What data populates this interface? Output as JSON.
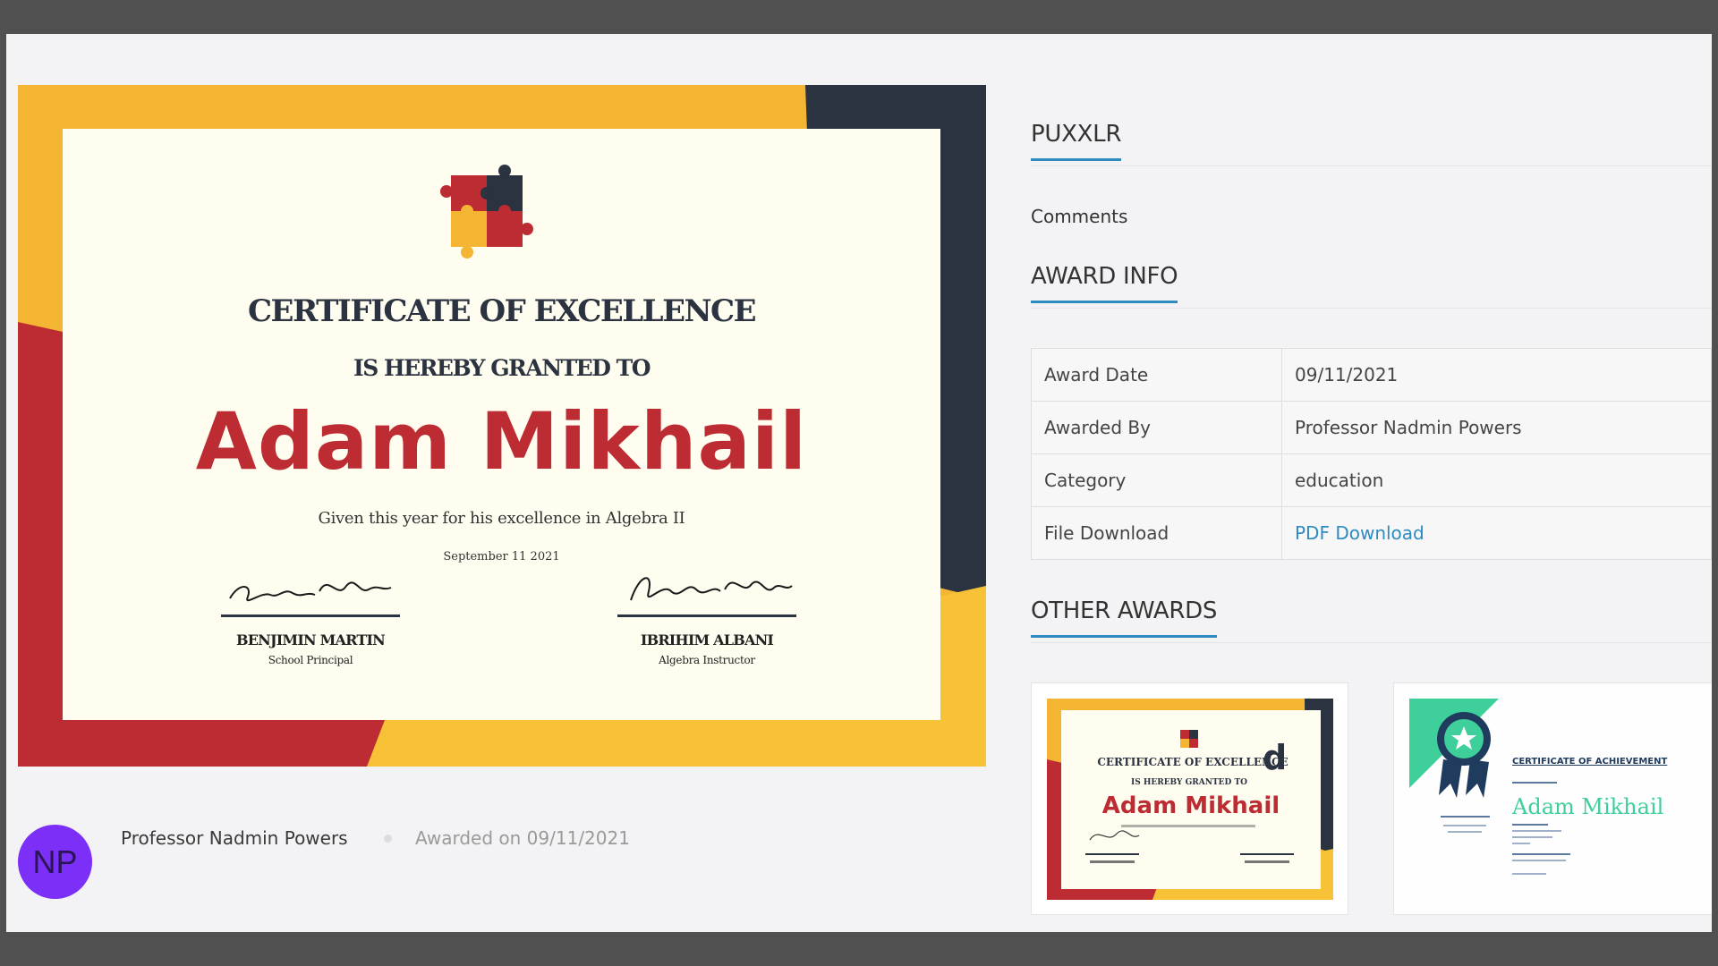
{
  "certificate": {
    "title": "CERTIFICATE OF EXCELLENCE",
    "subtitle": "IS HEREBY GRANTED TO",
    "recipient": "Adam Mikhail",
    "description": "Given this year for his excellence in Algebra II",
    "date": "September 11 2021",
    "signers": [
      {
        "name": "BENJIMIN MARTIN",
        "role": "School Principal"
      },
      {
        "name": "IBRIHIM ALBANI",
        "role": "Algebra Instructor"
      }
    ],
    "colors": {
      "orange": "#f4b533",
      "navy": "#2b3240",
      "red": "#bd2c33",
      "yellow": "#f7c236"
    }
  },
  "author": {
    "initials": "NP",
    "name": "Professor Nadmin Powers",
    "awarded_on": "Awarded on 09/11/2021",
    "avatar_color": "#7b2ff7"
  },
  "sidebar": {
    "org_title": "PUXXLR",
    "comments_label": "Comments",
    "award_info_title": "AWARD INFO",
    "award_info": [
      {
        "label": "Award Date",
        "value": "09/11/2021"
      },
      {
        "label": "Awarded By",
        "value": "Professor Nadmin Powers"
      },
      {
        "label": "Category",
        "value": "education"
      },
      {
        "label": "File Download",
        "value": "PDF Download"
      }
    ],
    "other_awards_title": "OTHER AWARDS",
    "other_awards": [
      {
        "title": "CERTIFICATE OF EXCELLENCE",
        "subtitle": "IS HEREBY GRANTED TO",
        "recipient": "Adam Mikhail"
      },
      {
        "title": "CERTIFICATE OF ACHIEVEMENT",
        "recipient": "Adam Mikhail"
      }
    ],
    "accent_color": "#2e8bc0"
  }
}
